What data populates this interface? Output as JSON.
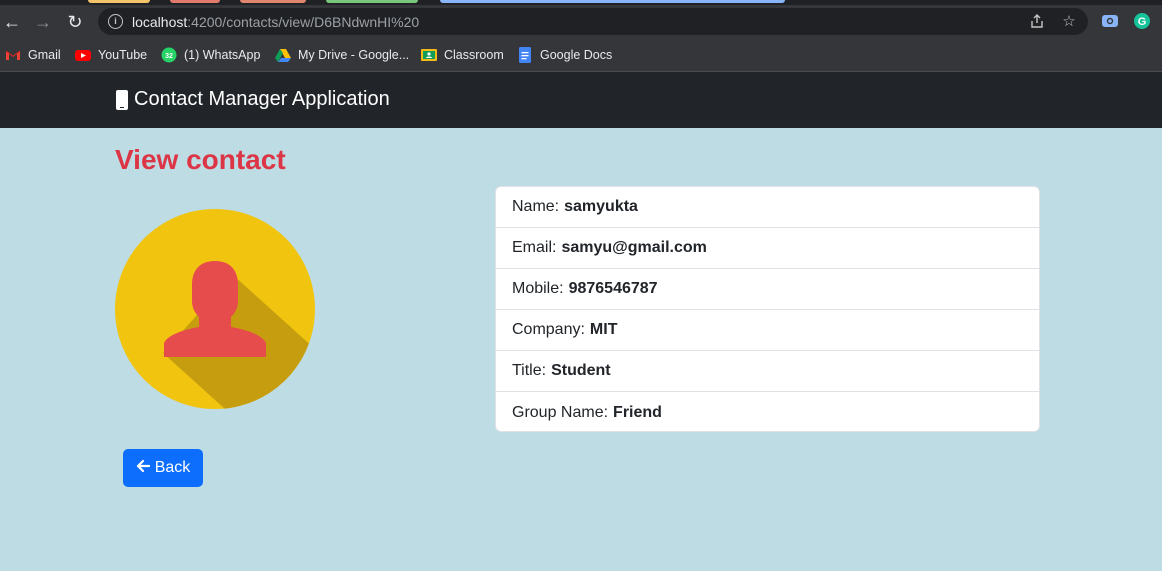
{
  "browser": {
    "url_host": "localhost",
    "url_rest": ":4200/contacts/view/D6BNdwnHI%20",
    "bookmarks": [
      {
        "label": "Gmail",
        "icon": "gmail-icon"
      },
      {
        "label": "YouTube",
        "icon": "youtube-icon"
      },
      {
        "label": "(1) WhatsApp",
        "icon": "whatsapp-icon",
        "badge": "32"
      },
      {
        "label": "My Drive - Google...",
        "icon": "google-drive-icon"
      },
      {
        "label": "Classroom",
        "icon": "classroom-icon"
      },
      {
        "label": "Google Docs",
        "icon": "google-docs-icon"
      }
    ]
  },
  "navbar": {
    "brand": "Contact Manager Application"
  },
  "page": {
    "title": "View contact",
    "back_label": "Back"
  },
  "contact": {
    "fields": [
      {
        "label": "Name:",
        "value": "samyukta"
      },
      {
        "label": "Email:",
        "value": "samyu@gmail.com"
      },
      {
        "label": "Mobile:",
        "value": "9876546787"
      },
      {
        "label": "Company:",
        "value": "MIT"
      },
      {
        "label": "Title:",
        "value": "Student"
      },
      {
        "label": "Group Name:",
        "value": "Friend"
      }
    ]
  },
  "colors": {
    "page_bg": "#bddce4",
    "navbar_bg": "#212529",
    "title_red": "#dc3545",
    "button_blue": "#0d6efd",
    "avatar_yellow": "#f1c40f",
    "avatar_person": "#e74c4c"
  }
}
